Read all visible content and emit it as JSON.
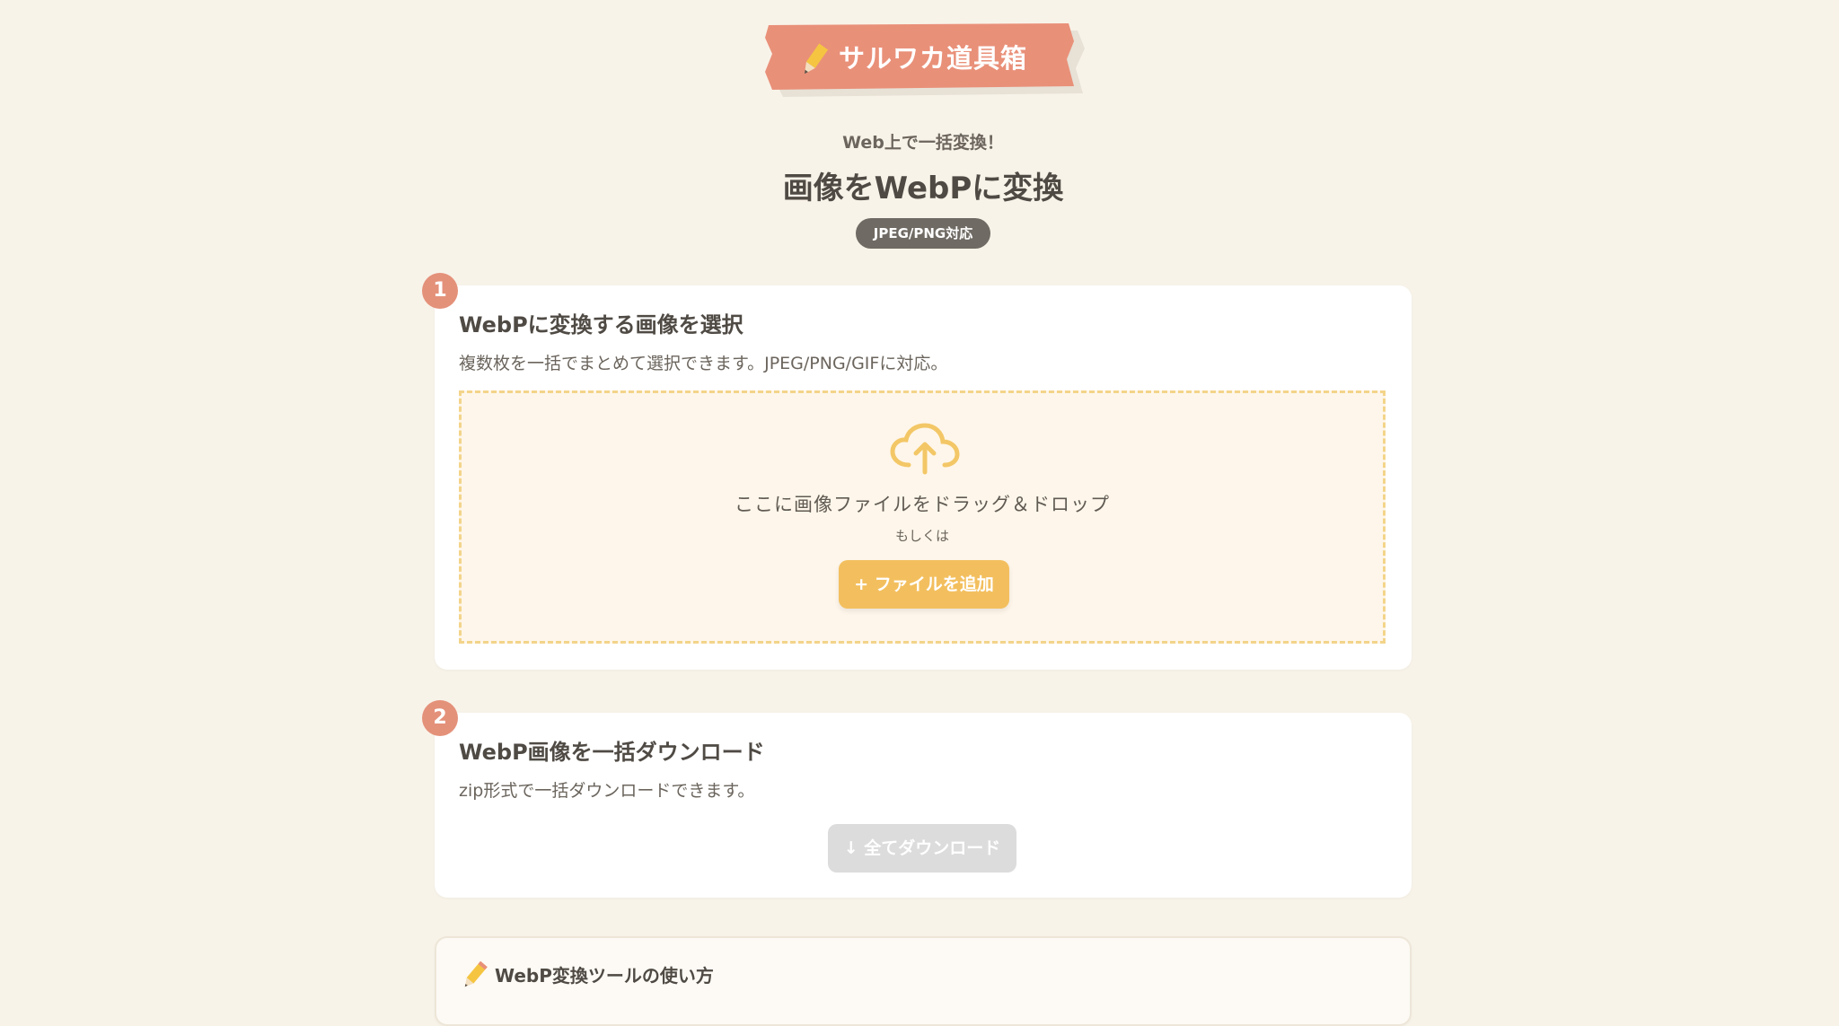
{
  "header": {
    "logo_text": "サルワカ道具箱",
    "subtitle": "Web上で一括変換！",
    "title": "画像をWebPに変換",
    "badge": "JPEG/PNG対応"
  },
  "colors": {
    "background": "#f8f3e9",
    "logo_ribbon": "#e99079",
    "accent_yellow": "#f3bf5e",
    "step_badge": "#e4917a",
    "dropzone_border": "#f3d48a",
    "disabled_button": "#dcdcdc"
  },
  "step1": {
    "number": "1",
    "title": "WebPに変換する画像を選択",
    "description": "複数枚を一括でまとめて選択できます。JPEG/PNG/GIFに対応。",
    "dropzone": {
      "icon": "cloud-upload-icon",
      "text": "ここに画像ファイルをドラッグ＆ドロップ",
      "or_text": "もしくは",
      "button_label": "+ ファイルを追加"
    }
  },
  "step2": {
    "number": "2",
    "title": "WebP画像を一括ダウンロード",
    "description": "zip形式で一括ダウンロードできます。",
    "button_label": "↓ 全てダウンロード",
    "button_disabled": true
  },
  "howto": {
    "icon": "pencil-icon",
    "title": "WebP変換ツールの使い方"
  }
}
